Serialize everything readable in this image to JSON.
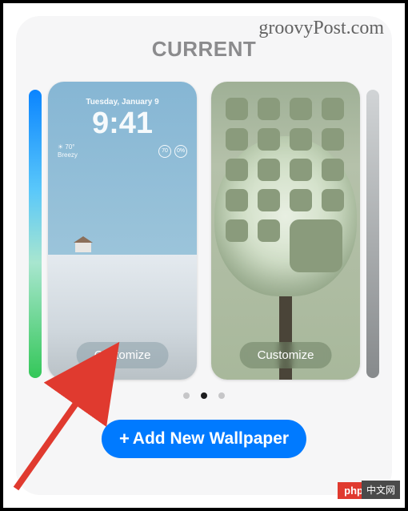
{
  "header": {
    "title": "CURRENT"
  },
  "watermark": {
    "site": "groovyPost.com",
    "php": "php",
    "cn": "中文网"
  },
  "lock_screen": {
    "date": "Tuesday, January 9",
    "time": "9:41",
    "weather": {
      "temp": "70°",
      "cond": "Breezy"
    },
    "ring1": "70",
    "ring2": "0%",
    "customize_label": "Customize"
  },
  "home_screen": {
    "customize_label": "Customize"
  },
  "pagination": {
    "count": 3,
    "active_index": 1
  },
  "add_button": {
    "label": "Add New Wallpaper"
  }
}
